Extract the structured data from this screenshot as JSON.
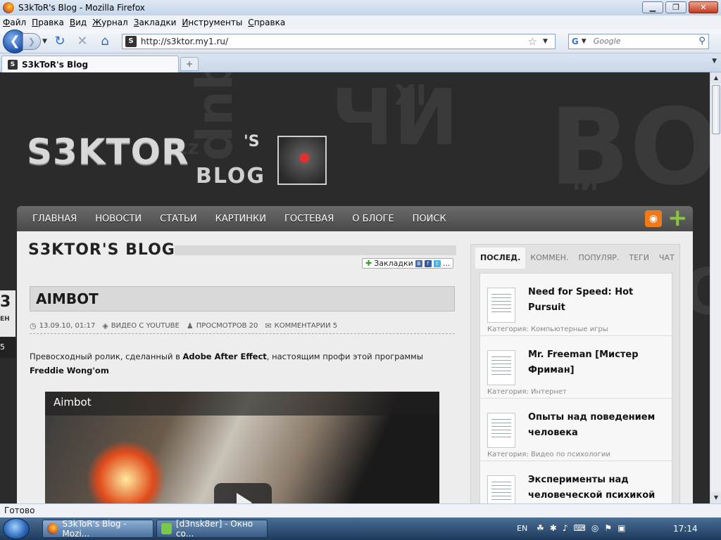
{
  "window": {
    "title": "S3kToR's Blog - Mozilla Firefox",
    "minimize": "▁",
    "maximize": "❐",
    "close": "✕"
  },
  "menu": [
    "Файл",
    "Правка",
    "Вид",
    "Журнал",
    "Закладки",
    "Инструменты",
    "Справка"
  ],
  "navbar": {
    "url": "http://s3ktor.my1.ru/",
    "search_placeholder": "Google",
    "back": "❮",
    "forward": "❯",
    "reload": "↻",
    "stop": "✕",
    "home": "⌂"
  },
  "tabs": [
    {
      "label": "S3kToR's Blog",
      "badge": "S"
    }
  ],
  "new_tab": "+",
  "site": {
    "logo_main": "S3KTOR",
    "logo_s": "'S",
    "logo_sub": "BLOG",
    "bg_letters": [
      "dnb",
      "ЧИ",
      "BOG",
      "XI",
      "zz",
      "ЧИ",
      "BO"
    ],
    "nav": [
      "ГЛАВНАЯ",
      "НОВОСТИ",
      "СТАТЬИ",
      "КАРТИНКИ",
      "ГОСТЕВАЯ",
      "О БЛОГЕ",
      "ПОИСК"
    ],
    "blog_title": "S3KTOR'S BLOG",
    "bookmarks_label": "Закладки",
    "bookmark_tiles": [
      "B",
      "f",
      "t",
      "..."
    ],
    "date": {
      "day": "3",
      "month": "ЕН",
      "comments": "5"
    },
    "post": {
      "title": "AIMBOT",
      "datetime": "13.09.10, 01:17",
      "category": "ВИДЕО С YOUTUBE",
      "views": "ПРОСМОТРОВ 20",
      "comments": "КОММЕНТАРИИ 5",
      "text_1": "Превосходный ролик, сделанный в ",
      "text_bold_1": "Adobe After Effect",
      "text_2": ", настоящим профи этой программы ",
      "text_bold_2": "Freddie Wong'om",
      "video_title": "Aimbot"
    },
    "sidebar": {
      "tabs": [
        "ПОСЛЕД.",
        "КОММЕН.",
        "ПОПУЛЯР.",
        "ТЕГИ",
        "ЧАТ"
      ],
      "items": [
        {
          "title": "Need for Speed: Hot Pursuit",
          "category": "Категория: Компьютерные игры"
        },
        {
          "title": "Mr. Freeman [Мистер Фриман]",
          "category": "Категория: Интернет"
        },
        {
          "title": "Опыты над поведением человека",
          "category": "Категория: Видео по психологии"
        },
        {
          "title": "Эксперименты над человеческой психикой",
          "category": ""
        }
      ]
    }
  },
  "status": "Готово",
  "taskbar": {
    "tasks": [
      "S3kToR's Blog - Mozi...",
      "[d3nsk8er] - Окно со..."
    ],
    "lang": "EN",
    "clock": "17:14"
  },
  "colors": {
    "accent": "#1e4fa8",
    "rss": "#f07a1a",
    "plus": "#8ac83a"
  }
}
